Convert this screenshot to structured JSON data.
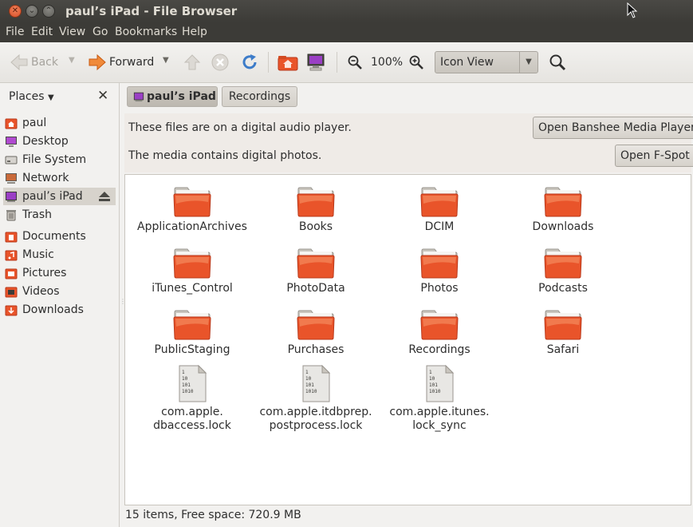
{
  "window": {
    "title": "paul’s iPad - File Browser"
  },
  "menu": [
    "File",
    "Edit",
    "View",
    "Go",
    "Bookmarks",
    "Help"
  ],
  "toolbar": {
    "back": "Back",
    "forward": "Forward",
    "zoom": "100%",
    "view_mode": "Icon View"
  },
  "sidebar": {
    "heading": "Places",
    "items": [
      {
        "label": "paul",
        "icon": "home-folder-icon"
      },
      {
        "label": "Desktop",
        "icon": "desktop-icon"
      },
      {
        "label": "File System",
        "icon": "drive-icon"
      },
      {
        "label": "Network",
        "icon": "network-icon"
      },
      {
        "label": "paul’s iPad",
        "icon": "ipad-icon",
        "selected": true
      },
      {
        "label": "Trash",
        "icon": "trash-icon"
      },
      {
        "label": "Documents",
        "icon": "folder-icon"
      },
      {
        "label": "Music",
        "icon": "folder-icon"
      },
      {
        "label": "Pictures",
        "icon": "folder-icon"
      },
      {
        "label": "Videos",
        "icon": "folder-icon"
      },
      {
        "label": "Downloads",
        "icon": "folder-icon"
      }
    ]
  },
  "location": [
    "paul’s iPad",
    "Recordings"
  ],
  "infobar": {
    "msg1": "These files are on a digital audio player.",
    "btn1": "Open Banshee Media Player",
    "msg2": "The media contains digital photos.",
    "btn2": "Open F-Spot"
  },
  "files": [
    {
      "name": "ApplicationArchives",
      "kind": "folder"
    },
    {
      "name": "Books",
      "kind": "folder"
    },
    {
      "name": "DCIM",
      "kind": "folder"
    },
    {
      "name": "Downloads",
      "kind": "folder"
    },
    {
      "name": "iTunes_Control",
      "kind": "folder"
    },
    {
      "name": "PhotoData",
      "kind": "folder"
    },
    {
      "name": "Photos",
      "kind": "folder"
    },
    {
      "name": "Podcasts",
      "kind": "folder"
    },
    {
      "name": "PublicStaging",
      "kind": "folder"
    },
    {
      "name": "Purchases",
      "kind": "folder"
    },
    {
      "name": "Recordings",
      "kind": "folder"
    },
    {
      "name": "Safari",
      "kind": "folder"
    },
    {
      "name": "com.apple.\ndbaccess.lock",
      "kind": "binary"
    },
    {
      "name": "com.apple.itdbprep.\npostprocess.lock",
      "kind": "binary"
    },
    {
      "name": "com.apple.itunes.\nlock_sync",
      "kind": "binary"
    }
  ],
  "status": "15 items, Free space: 720.9 MB",
  "colors": {
    "folder": "#e9542a",
    "titlebar": "#3c3b37",
    "accent": "#dd4814"
  }
}
